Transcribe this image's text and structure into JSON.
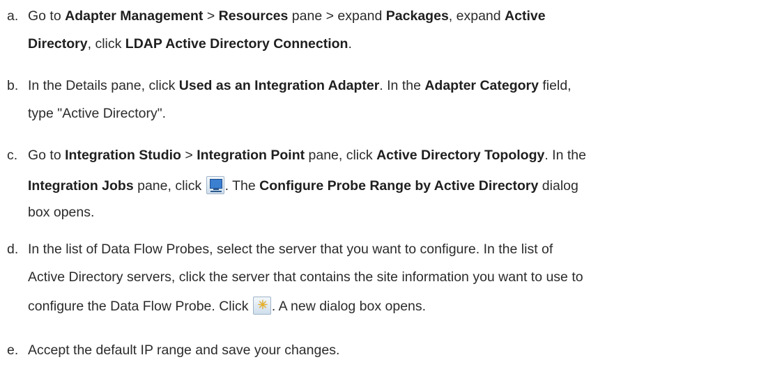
{
  "steps": [
    {
      "letter": "a.",
      "lines": [
        [
          {
            "t": "Go to "
          },
          {
            "t": "Adapter Management",
            "b": true
          },
          {
            "t": " > "
          },
          {
            "t": "Resources",
            "b": true
          },
          {
            "t": " pane > expand "
          },
          {
            "t": "Packages",
            "b": true
          },
          {
            "t": ", expand "
          },
          {
            "t": "Active",
            "b": true
          }
        ],
        [
          {
            "t": "Directory",
            "b": true
          },
          {
            "t": ", click "
          },
          {
            "t": "LDAP Active Directory Connection",
            "b": true
          },
          {
            "t": "."
          }
        ]
      ]
    },
    {
      "letter": "b.",
      "lines": [
        [
          {
            "t": "In the Details pane, click "
          },
          {
            "t": "Used as an Integration Adapter",
            "b": true
          },
          {
            "t": ". In the "
          },
          {
            "t": "Adapter Category",
            "b": true
          },
          {
            "t": " field,"
          }
        ],
        [
          {
            "t": "type \"Active Directory\"."
          }
        ]
      ]
    },
    {
      "letter": "c.",
      "lines": [
        [
          {
            "t": "Go to "
          },
          {
            "t": "Integration Studio",
            "b": true
          },
          {
            "t": " > "
          },
          {
            "t": "Integration Point",
            "b": true
          },
          {
            "t": " pane, click "
          },
          {
            "t": "Active Directory Topology",
            "b": true
          },
          {
            "t": ". In the"
          }
        ],
        [
          {
            "t": "Integration Jobs",
            "b": true
          },
          {
            "t": " pane, click "
          },
          {
            "icon": "probe-range-monitor-icon"
          },
          {
            "t": ". The "
          },
          {
            "t": "Configure Probe Range by Active Directory",
            "b": true
          },
          {
            "t": " dialog"
          }
        ],
        [
          {
            "t": "box opens."
          }
        ]
      ]
    },
    {
      "letter": "d.",
      "lines": [
        [
          {
            "t": "In the list of Data Flow Probes, select the server that you want to configure. In the list of"
          }
        ],
        [
          {
            "t": "Active Directory servers, click the server that contains the site information you want to use to"
          }
        ],
        [
          {
            "t": "configure the Data Flow Probe. Click "
          },
          {
            "icon": "new-item-star-icon"
          },
          {
            "t": ". A new dialog box opens."
          }
        ]
      ]
    },
    {
      "letter": "e.",
      "lines": [
        [
          {
            "t": "Accept the default IP range and save your changes."
          }
        ]
      ]
    }
  ]
}
